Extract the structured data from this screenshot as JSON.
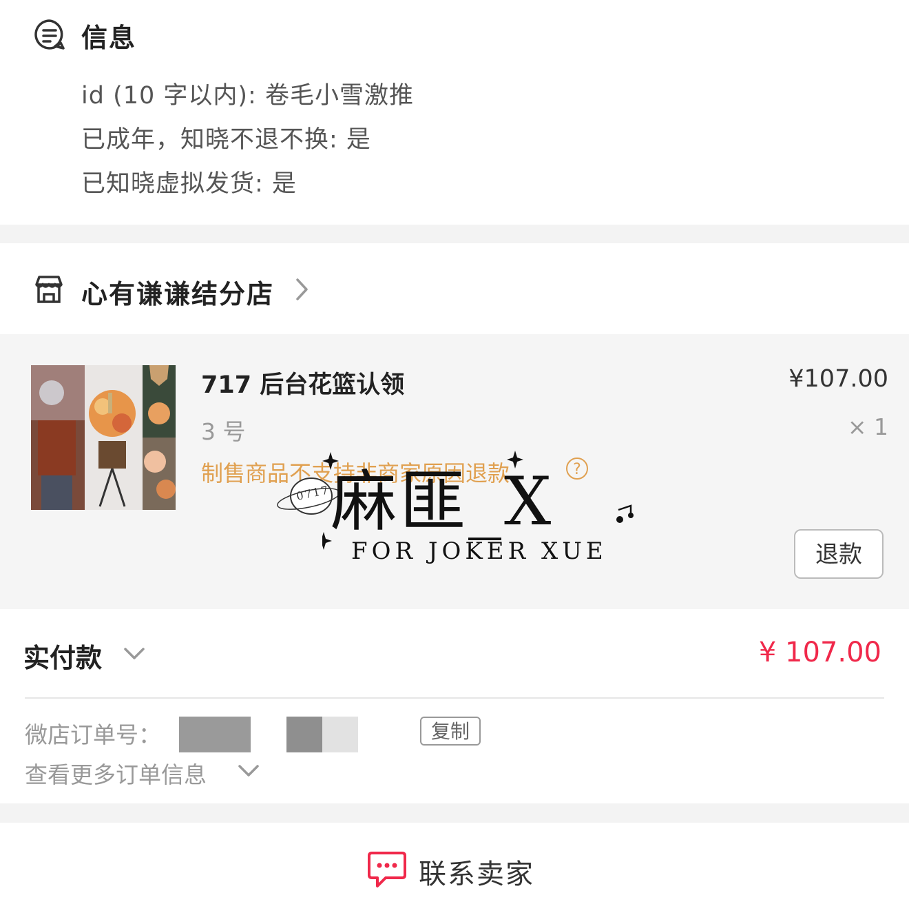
{
  "info": {
    "title": "信息",
    "lines": [
      "id (10 字以内): 卷毛小雪激推",
      "已成年，知晓不退不换: 是",
      "已知晓虚拟发货: 是"
    ]
  },
  "shop": {
    "name": "心有谦谦结分店"
  },
  "item": {
    "title": "717 后台花篮认领",
    "price": "¥107.00",
    "spec": "3 号",
    "qty": "× 1",
    "warning": "制售商品不支持非商家原因退款",
    "help_icon": "?",
    "refund_label": "退款"
  },
  "watermark": {
    "name": "麻匪_X",
    "subtitle": "FOR JOKER XUE",
    "ring_text": "0717"
  },
  "payment": {
    "label": "实付款",
    "amount": "¥ 107.00",
    "order_no_label": "微店订单号：",
    "copy_label": "复制",
    "more_info": "查看更多订单信息"
  },
  "contact": {
    "label": "联系卖家"
  },
  "colors": {
    "price_red": "#f0284a",
    "warning_orange": "#e0a050"
  },
  "icons": [
    "message-list-icon",
    "store-icon",
    "chevron-right-icon",
    "chevron-down-icon",
    "chat-bubble-icon"
  ]
}
